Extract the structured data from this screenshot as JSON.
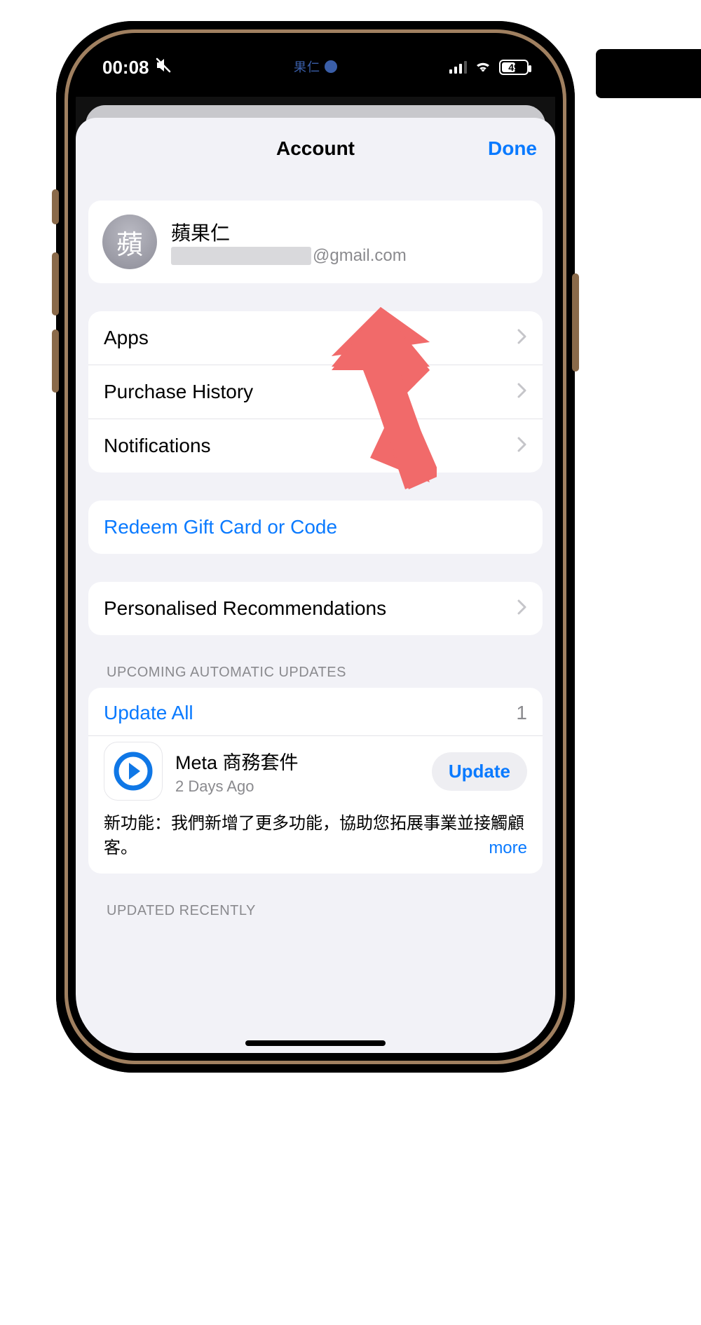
{
  "status": {
    "time": "00:08",
    "battery_percent": "49"
  },
  "notch": {
    "label": "果仁"
  },
  "nav": {
    "title": "Account",
    "done": "Done"
  },
  "profile": {
    "avatar_char": "蘋",
    "name": "蘋果仁",
    "email_suffix": "@gmail.com"
  },
  "menu": {
    "apps": "Apps",
    "purchase_history": "Purchase History",
    "notifications": "Notifications",
    "redeem": "Redeem Gift Card or Code",
    "recommendations": "Personalised Recommendations"
  },
  "sections": {
    "upcoming": "UPCOMING AUTOMATIC UPDATES",
    "updated_recently": "UPDATED RECENTLY"
  },
  "updates": {
    "update_all": "Update All",
    "count": "1",
    "app": {
      "title": "Meta 商務套件",
      "subtitle": "2 Days Ago",
      "button": "Update",
      "desc": "新功能：我們新增了更多功能，協助您拓展事業並接觸顧客。",
      "more": "more"
    }
  }
}
